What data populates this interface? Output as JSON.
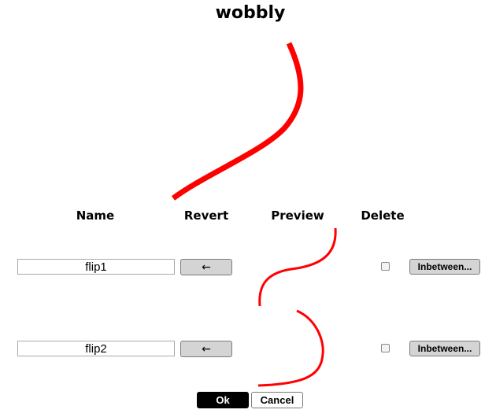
{
  "title": "wobbly",
  "columns": {
    "name": "Name",
    "revert": "Revert",
    "preview": "Preview",
    "delete": "Delete"
  },
  "rows": [
    {
      "name": "flip1",
      "revert_label": "←",
      "delete_checked": false,
      "inbetween_label": "Inbetween..."
    },
    {
      "name": "flip2",
      "revert_label": "←",
      "delete_checked": false,
      "inbetween_label": "Inbetween..."
    }
  ],
  "footer": {
    "ok_label": "Ok",
    "cancel_label": "Cancel"
  },
  "colors": {
    "stroke": "#ff0000",
    "ok_background": "#000000",
    "button_background": "#d4d4d4"
  }
}
